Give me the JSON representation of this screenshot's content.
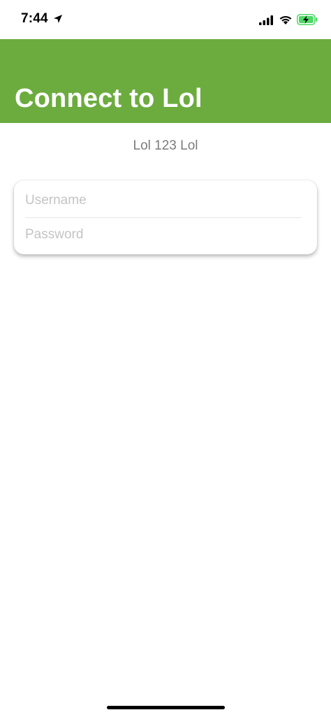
{
  "status_bar": {
    "time": "7:44",
    "icons": [
      "location-arrow-icon",
      "cellular-signal-icon",
      "wifi-icon",
      "battery-charging-icon"
    ]
  },
  "header": {
    "title": "Connect to Lol",
    "color": "#6cac3f"
  },
  "subtitle": "Lol 123 Lol",
  "login_form": {
    "username_placeholder": "Username",
    "username_value": "",
    "password_placeholder": "Password",
    "password_value": ""
  },
  "colors": {
    "accent": "#6cac3f",
    "battery": "#4cd964"
  }
}
